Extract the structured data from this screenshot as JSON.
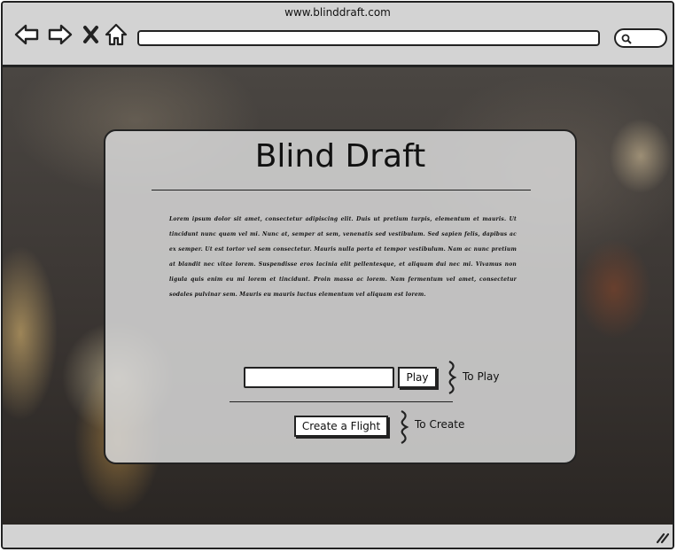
{
  "browser": {
    "url": "www.blinddraft.com"
  },
  "page": {
    "title": "Blind Draft",
    "body_text": "Lorem ipsum dolor sit amet, consectetur adipiscing elit. Duis ut pretium turpis, elementum et mauris. Ut tincidunt nunc quam vel mi. Nunc at, semper at sem, venenatis sed vestibulum. Sed sapien felis, dapibus ac ex semper. Ut est tortor vel sem consectetur. Mauris nulla porta et tempor vestibulum. Nam ac nunc pretium at blandit nec vitae lorem. Suspendisse eros lacinia elit pellentesque, et aliquam dui nec mi. Vivamus non ligula quis enim eu mi lorem et tincidunt. Proin massa ac lorem. Nam fermentum vel amet, consectetur sodales pulvinar sem. Mauris eu mauris luctus elementum vel aliquam est lorem.",
    "play_button": "Play",
    "play_note": "To Play",
    "create_button": "Create a Flight",
    "create_note": "To Create"
  }
}
